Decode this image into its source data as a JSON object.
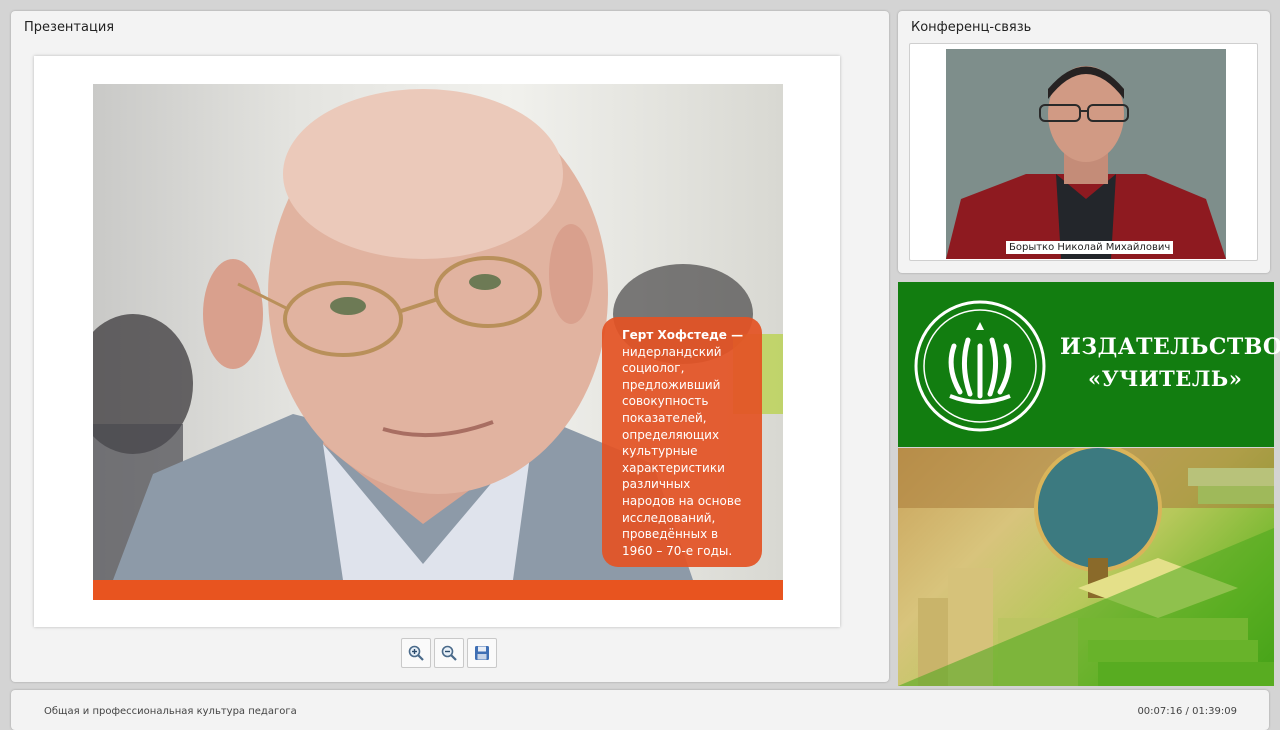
{
  "presentation": {
    "title": "Презентация",
    "caption": {
      "name": "Герт Хофстеде —",
      "lines": [
        "нидерландский",
        "социолог,",
        "предложивший",
        "совокупность",
        "показателей,",
        "определяющих",
        "культурные",
        "характеристики",
        "различных",
        "народов на основе",
        "исследований,",
        "проведённых в",
        "1960 – 70-е годы."
      ]
    },
    "toolbar": {
      "zoom_in_icon": "zoom-in-icon",
      "zoom_out_icon": "zoom-out-icon",
      "save_icon": "save-icon"
    },
    "colors": {
      "accent": "#e8541f"
    }
  },
  "conference": {
    "title": "Конференц-связь",
    "speaker_name": "Борытко Николай Михайлович"
  },
  "publisher": {
    "line1": "ИЗДАТЕЛЬСТВО",
    "line2": "«УЧИТЕЛЬ»",
    "color": "#127d10"
  },
  "footer": {
    "course_title": "Общая и профессиональная культура педагога",
    "time": "00:07:16 / 01:39:09"
  }
}
